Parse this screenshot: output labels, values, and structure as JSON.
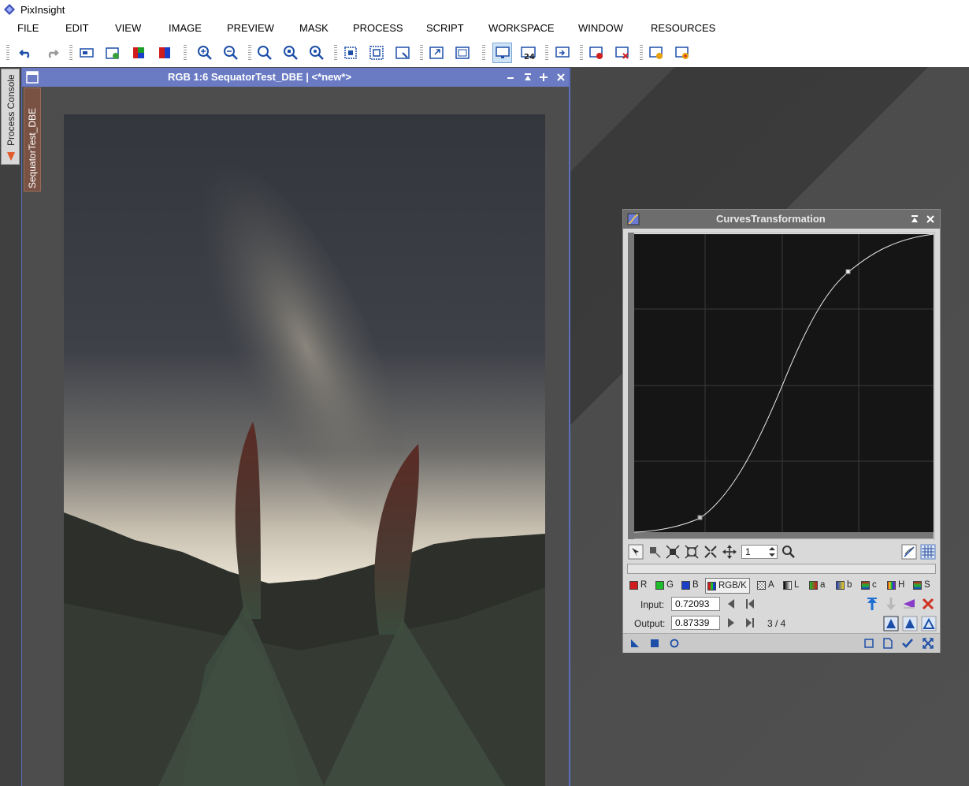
{
  "app": {
    "title": "PixInsight"
  },
  "menu": [
    "FILE",
    "EDIT",
    "VIEW",
    "IMAGE",
    "PREVIEW",
    "MASK",
    "PROCESS",
    "SCRIPT",
    "WORKSPACE",
    "WINDOW",
    "RESOURCES"
  ],
  "side_tabs": {
    "process_console": "Process Console"
  },
  "image_window": {
    "title": "RGB 1:6 SequatorTest_DBE | <*new*>",
    "side_tab": "SequatorTest_DBE"
  },
  "curves": {
    "title": "CurvesTransformation",
    "zoom_value": "1",
    "channels": [
      "R",
      "G",
      "B",
      "RGB/K",
      "A",
      "L",
      "a",
      "b",
      "c",
      "H",
      "S"
    ],
    "selected_channel": "RGB/K",
    "input_label": "Input:",
    "input_value": "0.72093",
    "output_label": "Output:",
    "output_value": "0.87339",
    "point_counter": "3 / 4",
    "points": [
      [
        0,
        0
      ],
      [
        0.23,
        0.07
      ],
      [
        0.72093,
        0.87339
      ],
      [
        1,
        1
      ]
    ]
  },
  "colors": {
    "accent": "#6a7bc4",
    "curves_title": "#6d6d6d"
  }
}
